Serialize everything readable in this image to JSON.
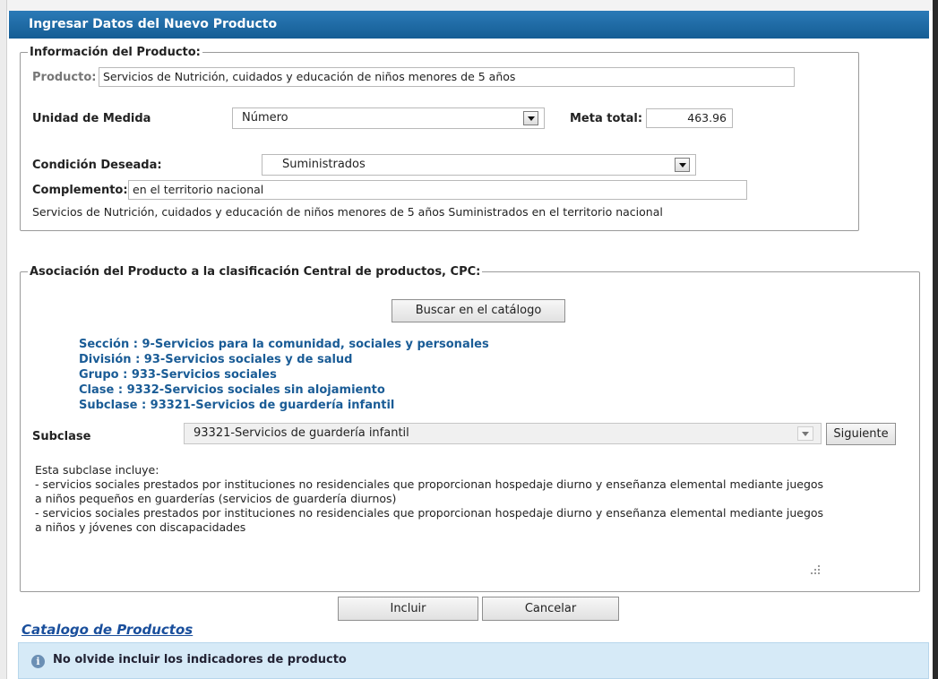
{
  "dialog": {
    "title": "Ingresar Datos del Nuevo Producto"
  },
  "producto_section": {
    "legend": "Información del Producto:",
    "producto_label": "Producto:",
    "producto_value": "Servicios de Nutrición, cuidados y educación de niños menores de 5 años",
    "unidad_label": "Unidad de Medida",
    "unidad_value": "Número",
    "meta_label": "Meta total:",
    "meta_value": "463.96",
    "condicion_label": "Condición Deseada:",
    "condicion_value": "Suministrados",
    "complemento_label": "Complemento:",
    "complemento_value": "en el territorio nacional",
    "summary": "Servicios de Nutrición, cuidados y educación de niños menores de 5 años Suministrados en el territorio nacional"
  },
  "cpc_section": {
    "legend": "Asociación del Producto a la clasificación Central de productos, CPC:",
    "search_button": "Buscar en el catálogo",
    "hierarchy": [
      "Sección : 9-Servicios para la comunidad, sociales y personales",
      "División : 93-Servicios sociales y de salud",
      "Grupo : 933-Servicios sociales",
      "Clase : 9332-Servicios sociales sin alojamiento",
      "Subclase : 93321-Servicios de guardería infantil"
    ],
    "subclase_label": "Subclase",
    "subclase_value": "93321-Servicios de guardería infantil",
    "next_button": "Siguiente",
    "description": "Esta subclase incluye:\n- servicios sociales prestados por instituciones no residenciales que proporcionan hospedaje diurno y enseñanza elemental mediante juegos\na niños pequeños en guarderías (servicios de guardería diurnos)\n- servicios sociales prestados por instituciones no residenciales que proporcionan hospedaje diurno y enseñanza elemental mediante juegos\na niños y jóvenes con discapacidades"
  },
  "actions": {
    "include_button": "Incluir",
    "cancel_button": "Cancelar"
  },
  "catalog_link": "Catalogo de Productos",
  "info": {
    "icon": "info-icon",
    "text": "No olvide incluir los indicadores de producto"
  },
  "colors": {
    "titlebar": "#1a6aa5",
    "cpc_text": "#1a5c96",
    "link": "#1a4f9c",
    "info_bg": "#d6eaf7"
  }
}
